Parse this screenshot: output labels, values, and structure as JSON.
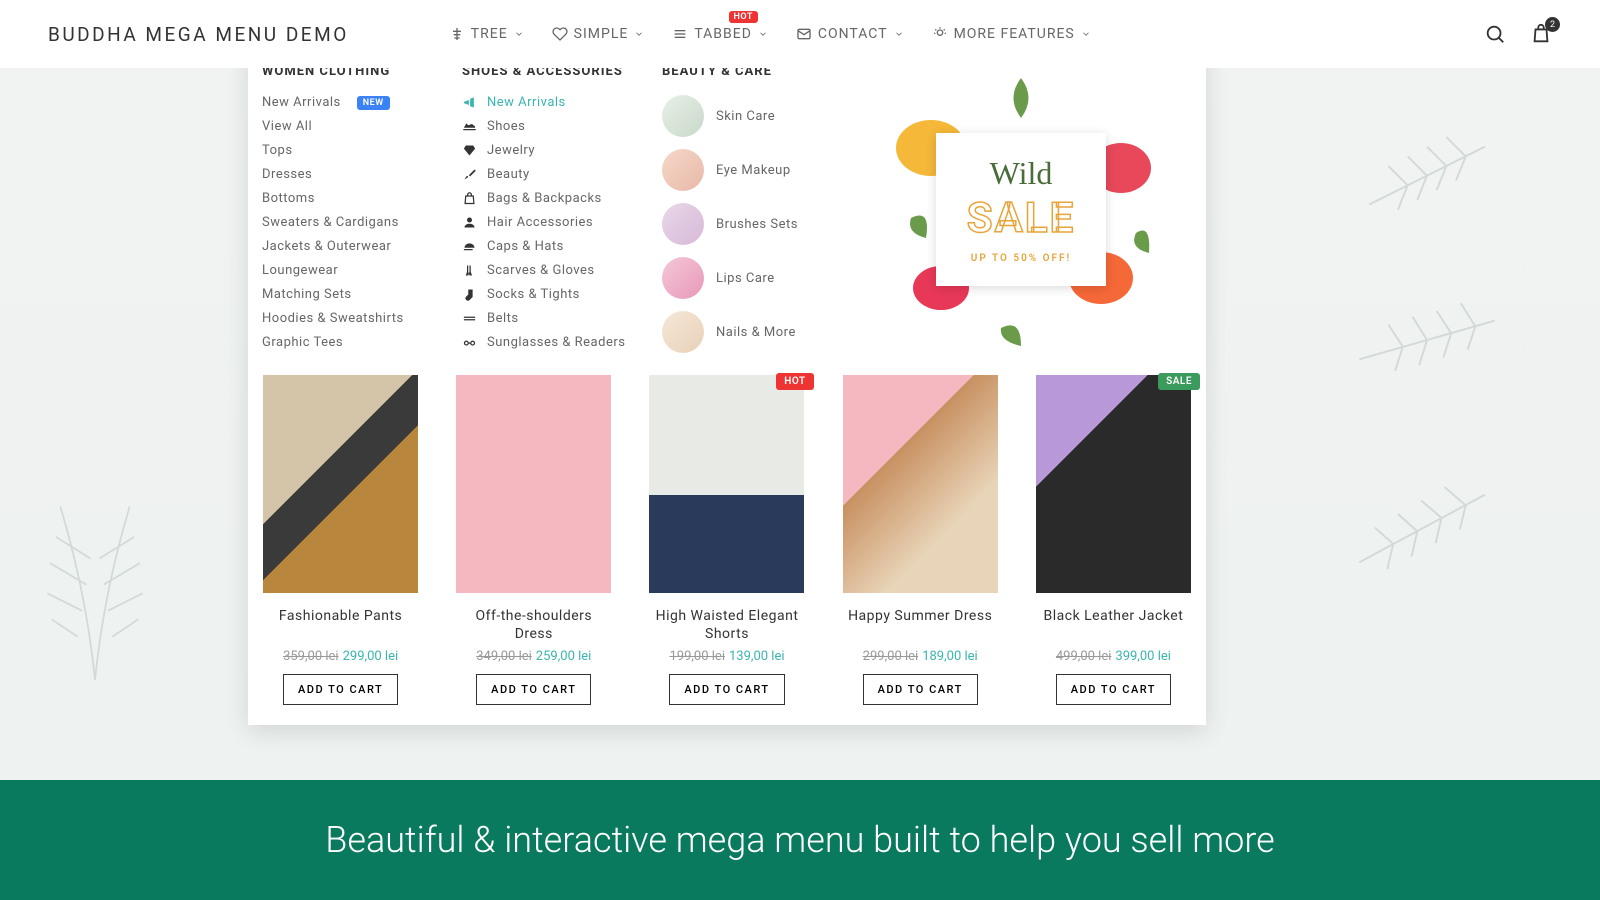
{
  "logo": "BUDDHA MEGA MENU DEMO",
  "cart_count": "2",
  "nav": [
    {
      "label": "TREE"
    },
    {
      "label": "SIMPLE"
    },
    {
      "label": "TABBED",
      "badge": "HOT"
    },
    {
      "label": "CONTACT"
    },
    {
      "label": "MORE FEATURES"
    }
  ],
  "mega": {
    "col1": {
      "title": "WOMEN CLOTHING",
      "items": [
        "New Arrivals",
        "View All",
        "Tops",
        "Dresses",
        "Bottoms",
        "Sweaters & Cardigans",
        "Jackets & Outerwear",
        "Loungewear",
        "Matching Sets",
        "Hoodies & Sweatshirts",
        "Graphic Tees"
      ],
      "new_badge": "NEW"
    },
    "col2": {
      "title": "SHOES & ACCESSORIES",
      "items": [
        "New Arrivals",
        "Shoes",
        "Jewelry",
        "Beauty",
        "Bags & Backpacks",
        "Hair Accessories",
        "Caps & Hats",
        "Scarves & Gloves",
        "Socks & Tights",
        "Belts",
        "Sunglasses & Readers"
      ]
    },
    "col3": {
      "title": "BEAUTY & CARE",
      "items": [
        "Skin Care",
        "Eye Makeup",
        "Brushes Sets",
        "Lips Care",
        "Nails & More"
      ]
    },
    "promo": {
      "script": "Wild",
      "sale": "SALE",
      "sub": "UP TO 50% OFF!"
    }
  },
  "products": [
    {
      "name": "Fashionable Pants",
      "old": "359,00 lei",
      "new": "299,00 lei",
      "btn": "ADD TO CART"
    },
    {
      "name": "Off-the-shoulders Dress",
      "old": "349,00 lei",
      "new": "259,00 lei",
      "btn": "ADD TO CART"
    },
    {
      "name": "High Waisted Elegant Shorts",
      "old": "199,00 lei",
      "new": "139,00 lei",
      "btn": "ADD TO CART",
      "badge": "HOT"
    },
    {
      "name": "Happy Summer Dress",
      "old": "299,00 lei",
      "new": "189,00 lei",
      "btn": "ADD TO CART"
    },
    {
      "name": "Black Leather Jacket",
      "old": "499,00 lei",
      "new": "399,00 lei",
      "btn": "ADD TO CART",
      "badge": "SALE"
    }
  ],
  "banner": "Beautiful & interactive mega menu built to help you sell more"
}
